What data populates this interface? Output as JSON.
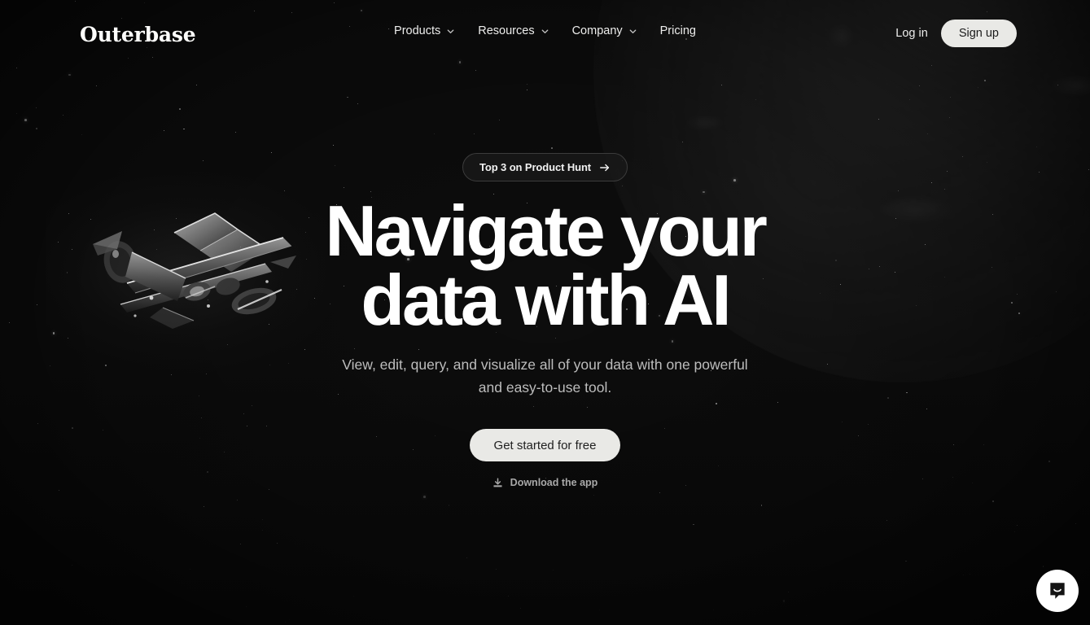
{
  "brand": {
    "logo_text": "Outerbase"
  },
  "nav": {
    "items": [
      {
        "label": "Products",
        "has_menu": true,
        "icon": "chevron-down-icon"
      },
      {
        "label": "Resources",
        "has_menu": true,
        "icon": "chevron-down-icon"
      },
      {
        "label": "Company",
        "has_menu": true,
        "icon": "chevron-down-icon"
      },
      {
        "label": "Pricing",
        "has_menu": false,
        "icon": ""
      }
    ]
  },
  "auth": {
    "login_label": "Log in",
    "signup_label": "Sign up"
  },
  "hero": {
    "badge": {
      "label": "Top 3 on Product Hunt",
      "icon": "arrow-right-icon"
    },
    "headline": "Navigate your data with AI",
    "subtitle": "View, edit, query, and visualize all of your data with one powerful and easy-to-use tool.",
    "cta_label": "Get started for free",
    "download_label": "Download the app",
    "download_icon": "download-icon"
  },
  "widgets": {
    "chat_icon": "chat-bubble-icon"
  },
  "decor": {
    "spacecraft": "satellite-illustration",
    "planet": "planet-illustration"
  },
  "colors": {
    "background": "#0d0d0d",
    "text_primary": "#ffffff",
    "text_secondary": "#bdbdbd",
    "accent_button": "#e9e9e6",
    "badge_border": "#3c3c3c"
  }
}
